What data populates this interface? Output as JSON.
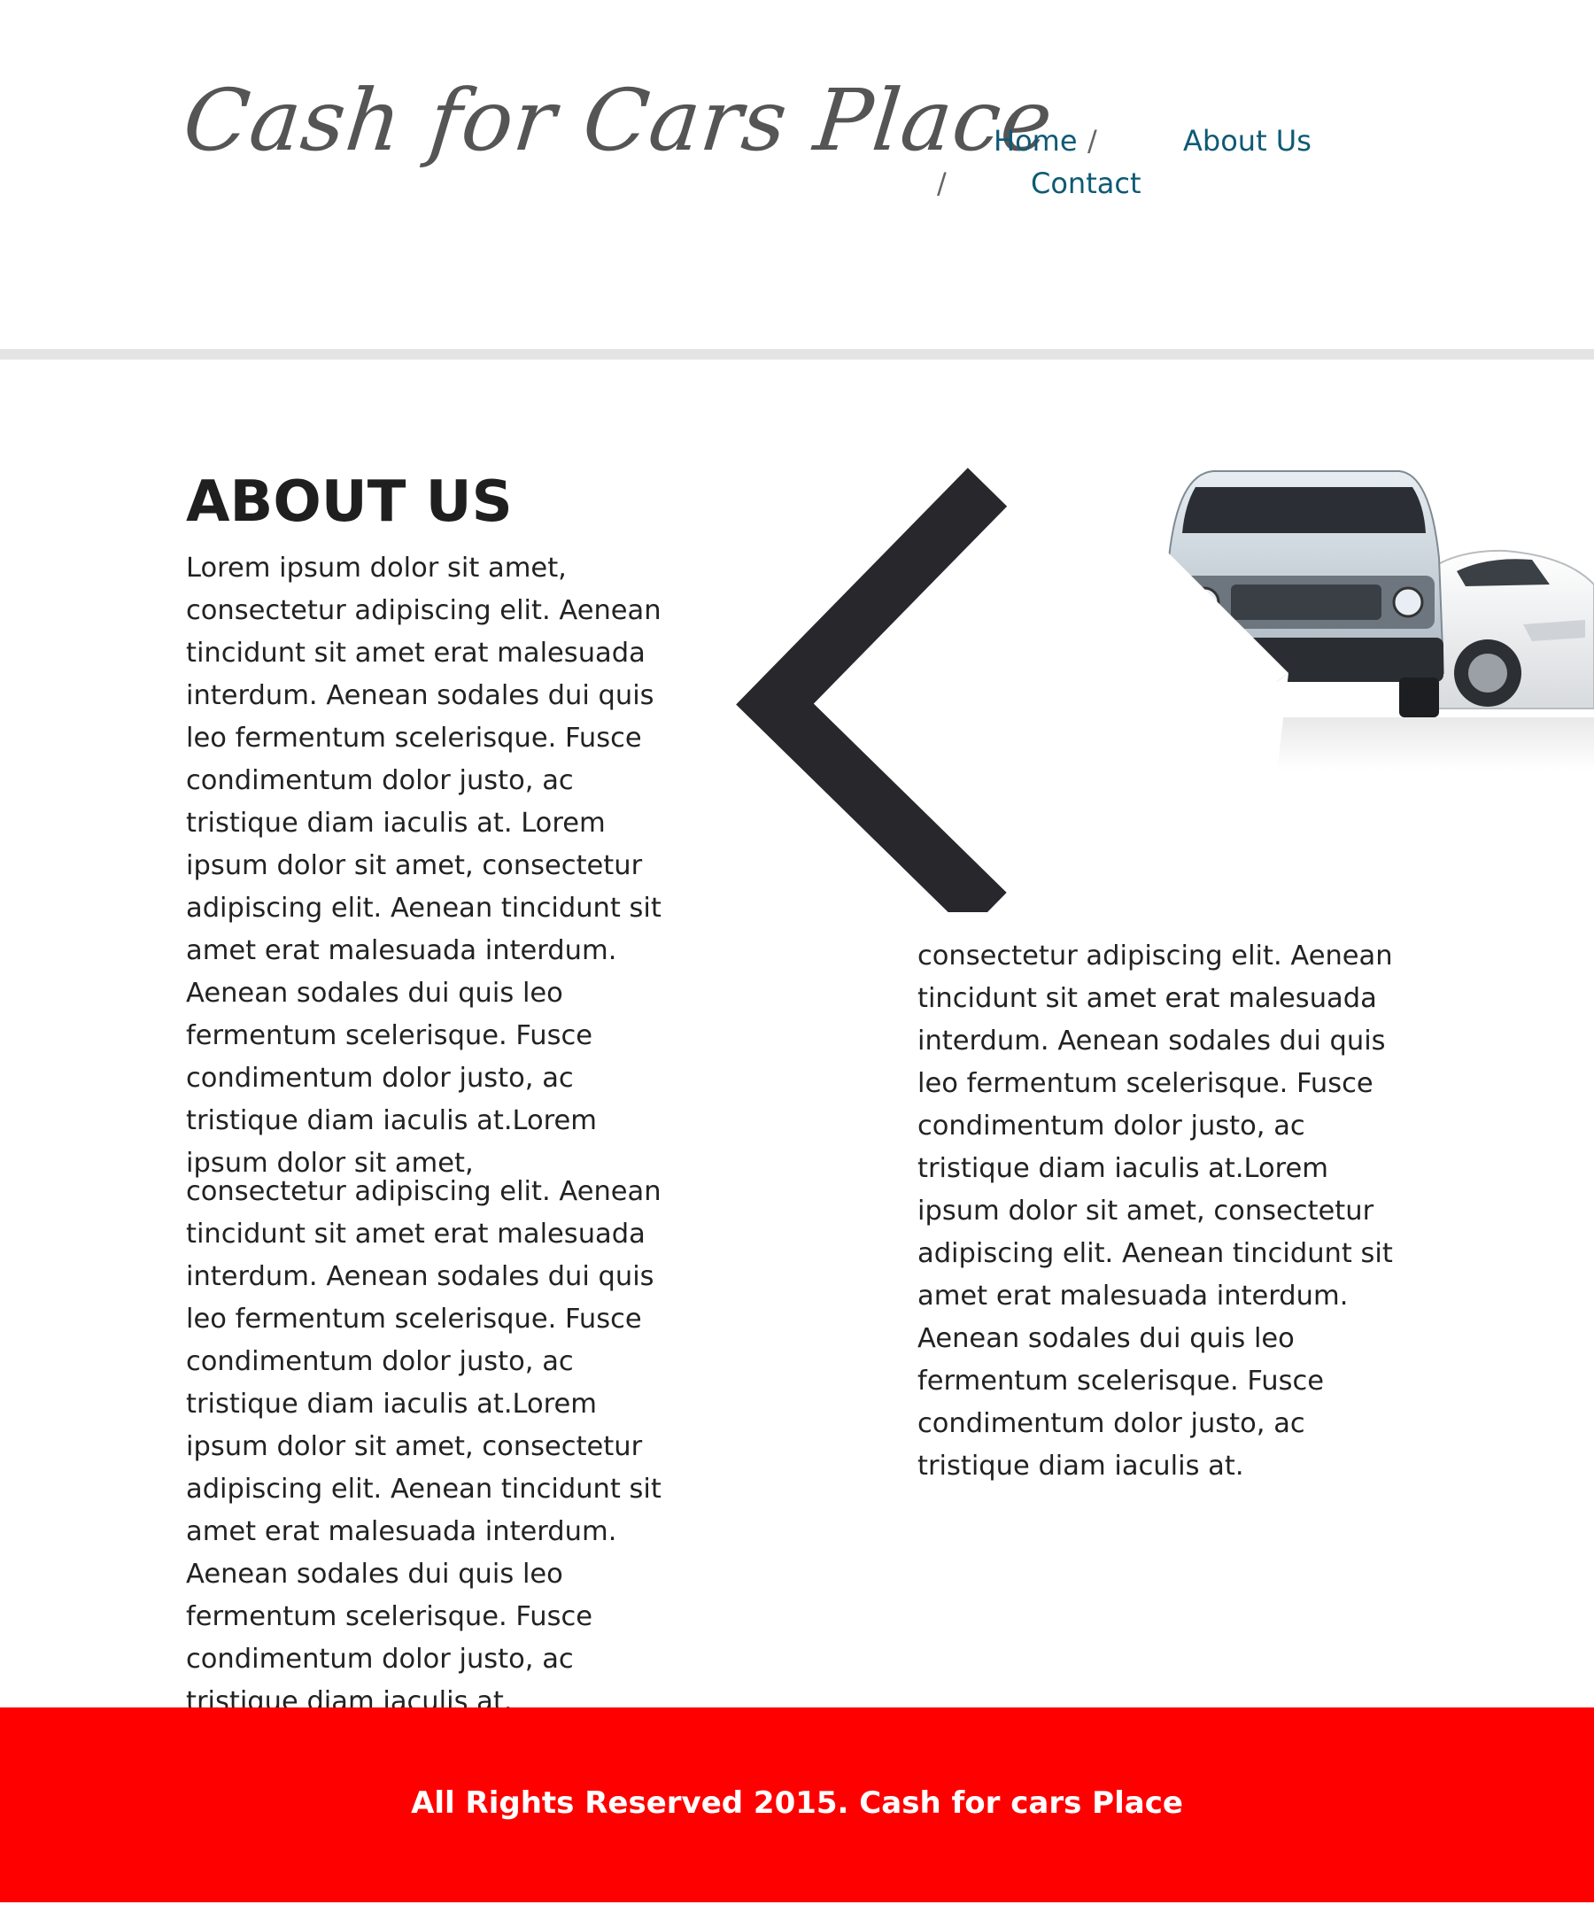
{
  "header": {
    "logo_text": "Cash for Cars Place",
    "nav": {
      "home": "Home",
      "separator": "/",
      "about": "About Us",
      "contact": "Contact"
    }
  },
  "main": {
    "heading": "ABOUT US",
    "paragraph_1": "Lorem ipsum dolor sit amet, consectetur adipiscing elit. Aenean tincidunt sit amet erat malesuada interdum. Aenean sodales dui quis leo fermentum scelerisque. Fusce condimentum dolor justo, ac tristique diam iaculis at. Lorem ipsum dolor sit amet, consectetur adipiscing elit. Aenean tincidunt sit amet erat malesuada interdum. Aenean sodales dui quis leo fermentum scelerisque. Fusce condimentum dolor justo, ac tristique diam iaculis at.Lorem ipsum dolor sit amet,",
    "paragraph_2": "consectetur adipiscing elit. Aenean tincidunt sit amet erat malesuada interdum. Aenean sodales dui quis leo fermentum scelerisque. Fusce condimentum dolor justo, ac tristique diam iaculis at.Lorem ipsum dolor sit amet, consectetur adipiscing elit. Aenean tincidunt sit amet erat malesuada interdum. Aenean sodales dui quis leo fermentum scelerisque. Fusce condimentum dolor justo, ac tristique diam iaculis at.",
    "paragraph_3": "consectetur adipiscing elit. Aenean tincidunt sit amet erat malesuada interdum. Aenean sodales dui quis leo fermentum scelerisque. Fusce condimentum dolor justo, ac tristique diam iaculis at.Lorem ipsum dolor sit amet, consectetur adipiscing elit. Aenean tincidunt sit amet erat malesuada interdum. Aenean sodales dui quis leo fermentum scelerisque. Fusce condimentum dolor justo, ac tristique diam iaculis at."
  },
  "slider": {
    "prev_icon": "chevron-left-icon",
    "image": "cars-photo"
  },
  "footer": {
    "text": "All Rights Reserved 2015. Cash for cars Place"
  },
  "colors": {
    "nav_link": "#0e5a75",
    "footer_bg": "#ff0000",
    "footer_text": "#ffffff",
    "arrow": "#27272c",
    "divider": "#e4e4e4"
  }
}
